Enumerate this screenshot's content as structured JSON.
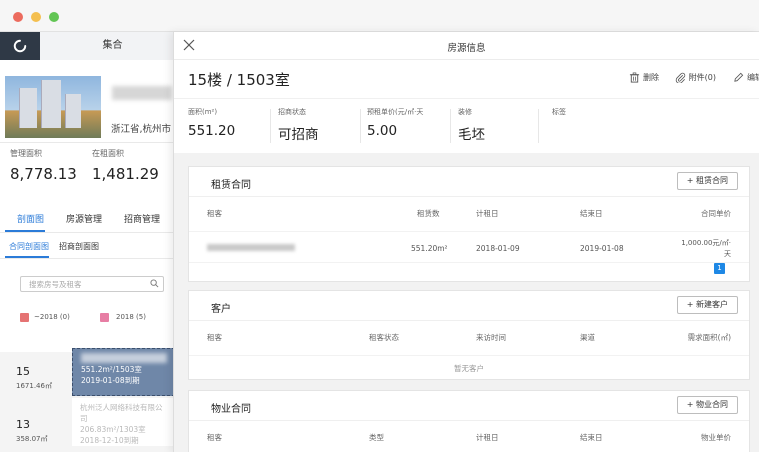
{
  "window": {
    "colors": {
      "close": "#ec6b5e",
      "minimize": "#f4bf4f",
      "zoom": "#62c554"
    }
  },
  "background_app": {
    "tab_label": "集合",
    "city": "浙江省,杭州市",
    "stats": [
      {
        "label": "管理面积",
        "value": "8,778.13"
      },
      {
        "label": "在租面积",
        "value": "1,481.29"
      }
    ],
    "nav": [
      "剖面图",
      "房源管理",
      "招商管理"
    ],
    "subnav": [
      "合同剖面图",
      "招商剖面图"
    ],
    "search_placeholder": "搜索房号及租客",
    "legend": [
      {
        "label": "~2018 (0)",
        "color": "#e57373"
      },
      {
        "label": "2018 (5)",
        "color": "#e77ea4"
      }
    ],
    "floors": [
      {
        "num": "15",
        "area": "1671.46㎡"
      },
      {
        "num": "13",
        "area": "358.07㎡"
      }
    ],
    "unit_selected": {
      "line1": "551.2m²/1503室",
      "line2": "2019-01-08到期"
    },
    "unit_other": {
      "line1": "杭州泛人网络科技有限公司",
      "line2": "206.83m²/1303室",
      "line3": "2018-12-10到期"
    }
  },
  "drawer": {
    "title": "房源信息",
    "room_title": "15楼 / 1503室",
    "actions": {
      "delete": "删除",
      "attach": "附件(0)",
      "edit": "编辑"
    },
    "info": [
      {
        "label": "面积(m²)",
        "value": "551.20"
      },
      {
        "label": "招商状态",
        "value": "可招商"
      },
      {
        "label": "预租单价(元/㎡·天",
        "value": "5.00"
      },
      {
        "label": "装修",
        "value": "毛坯"
      },
      {
        "label": "标签",
        "value": ""
      }
    ],
    "lease_contract": {
      "title": "租赁合同",
      "button": "+ 租赁合同",
      "columns": [
        "租客",
        "租赁数",
        "计租日",
        "结束日",
        "合同单价"
      ],
      "rows": [
        {
          "area": "551.20m²",
          "start": "2018-01-09",
          "end": "2019-01-08",
          "price": "1,000.00元/㎡·",
          "price_unit": "天"
        }
      ],
      "page": "1"
    },
    "customers": {
      "title": "客户",
      "button": "+ 新建客户",
      "columns": [
        "租客",
        "租客状态",
        "来访时间",
        "渠道",
        "需求面积(㎡)"
      ],
      "empty": "暂无客户"
    },
    "property_contract": {
      "title": "物业合同",
      "button": "+ 物业合同",
      "columns": [
        "租客",
        "类型",
        "计租日",
        "结束日",
        "物业单价"
      ]
    }
  }
}
